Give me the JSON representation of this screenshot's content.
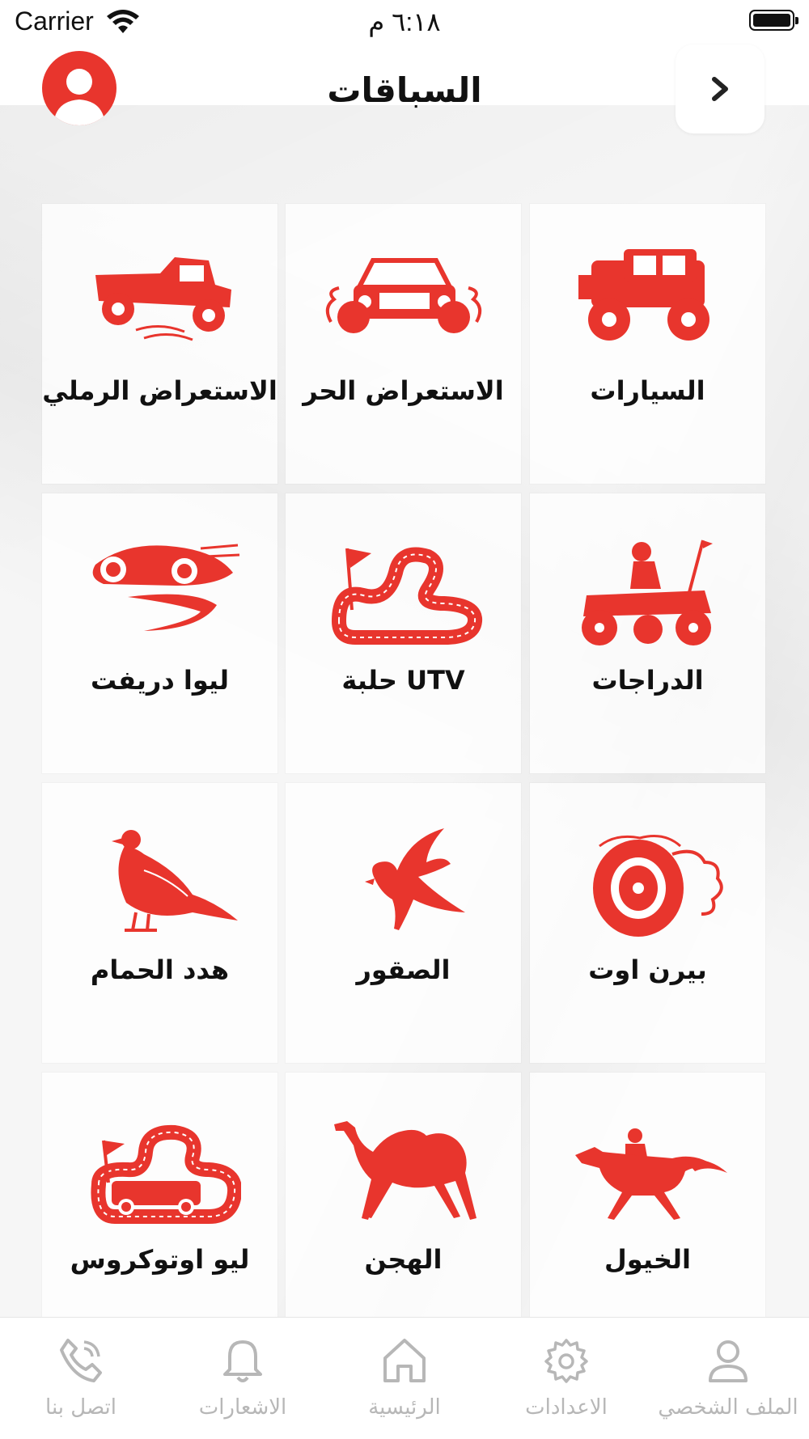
{
  "status_bar": {
    "carrier": "Carrier",
    "time": "٦:١٨ م"
  },
  "header": {
    "title": "السباقات"
  },
  "categories": [
    {
      "label": "السيارات",
      "icon": "offroad-truck-icon"
    },
    {
      "label": "الاستعراض الحر",
      "icon": "car-burnout-icon"
    },
    {
      "label": "الاستعراض الرملي",
      "icon": "pickup-sand-icon"
    },
    {
      "label": "الدراجات",
      "icon": "atv-rider-icon"
    },
    {
      "label": "حلبة UTV",
      "icon": "race-track-flag-icon"
    },
    {
      "label": "ليوا دريفت",
      "icon": "drift-car-icon"
    },
    {
      "label": "بيرن اوت",
      "icon": "burnout-tire-icon"
    },
    {
      "label": "الصقور",
      "icon": "falcon-icon"
    },
    {
      "label": "هدد الحمام",
      "icon": "pigeon-icon"
    },
    {
      "label": "الخيول",
      "icon": "racehorse-jockey-icon"
    },
    {
      "label": "الهجن",
      "icon": "camel-icon"
    },
    {
      "label": "ليو اوتوكروس",
      "icon": "autocross-track-icon"
    }
  ],
  "tabbar": [
    {
      "label": "الملف الشخصي",
      "icon": "profile-icon"
    },
    {
      "label": "الاعدادات",
      "icon": "gear-icon"
    },
    {
      "label": "الرئيسية",
      "icon": "home-icon"
    },
    {
      "label": "الاشعارات",
      "icon": "bell-icon"
    },
    {
      "label": "اتصل بنا",
      "icon": "phone-icon"
    }
  ],
  "colors": {
    "accent": "#e8352d",
    "tab_inactive": "#b7b7b7",
    "text": "#111111"
  }
}
